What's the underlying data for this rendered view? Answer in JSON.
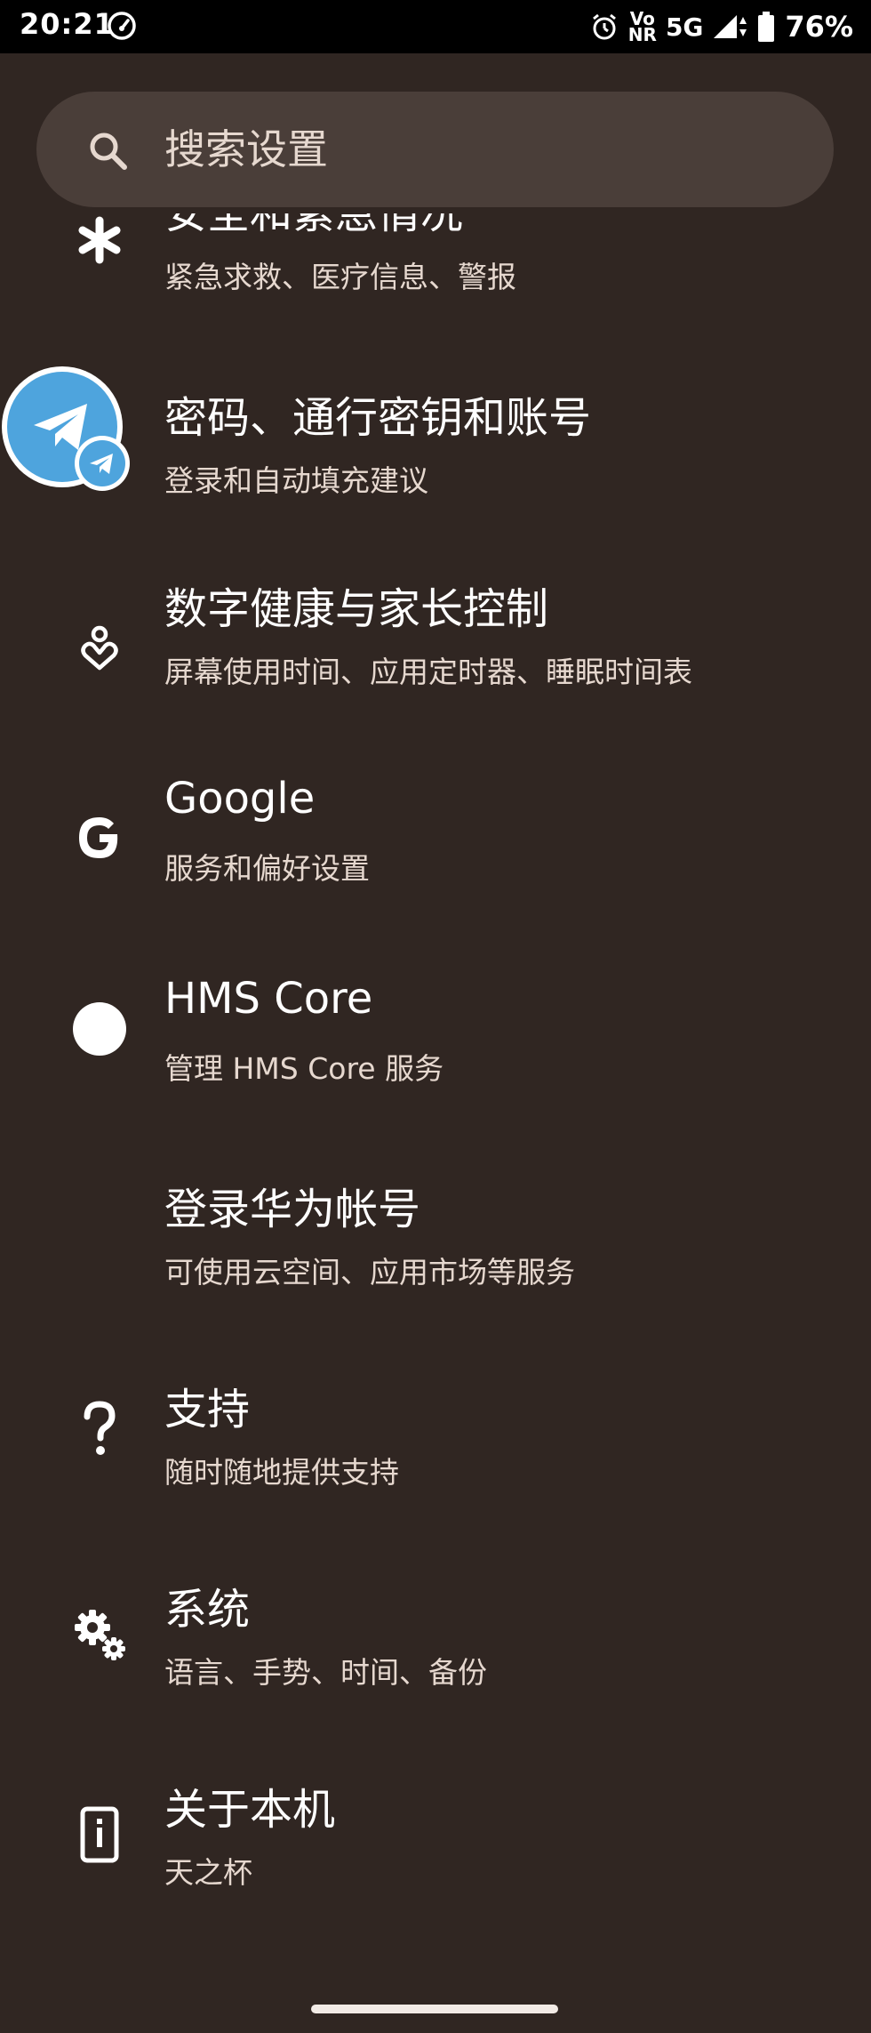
{
  "status_bar": {
    "time": "20:21",
    "network": "5G",
    "volte_top": "Vo",
    "volte_bottom": "NR",
    "battery": "76%"
  },
  "search": {
    "placeholder": "搜索设置"
  },
  "items": [
    {
      "title": "安全和紧急情况",
      "subtitle": "紧急求救、医疗信息、警报",
      "icon": "asterisk-icon"
    },
    {
      "title": "密码、通行密钥和账号",
      "subtitle": "登录和自动填充建议",
      "icon": "account-icon"
    },
    {
      "title": "数字健康与家长控制",
      "subtitle": "屏幕使用时间、应用定时器、睡眠时间表",
      "icon": "wellbeing-icon"
    },
    {
      "title": "Google",
      "subtitle": "服务和偏好设置",
      "icon": "google-icon"
    },
    {
      "title": "HMS Core",
      "subtitle": "管理 HMS Core 服务",
      "icon": "hms-core-icon"
    },
    {
      "title": "登录华为帐号",
      "subtitle": "可使用云空间、应用市场等服务",
      "icon": ""
    },
    {
      "title": "支持",
      "subtitle": "随时随地提供支持",
      "icon": "help-icon"
    },
    {
      "title": "系统",
      "subtitle": "语言、手势、时间、备份",
      "icon": "gears-icon"
    },
    {
      "title": "关于本机",
      "subtitle": "天之杯",
      "icon": "phone-info-icon"
    }
  ],
  "colors": {
    "background": "#302622",
    "search_bar": "#4a3e39",
    "telegram_blue": "#4ea4dd"
  }
}
